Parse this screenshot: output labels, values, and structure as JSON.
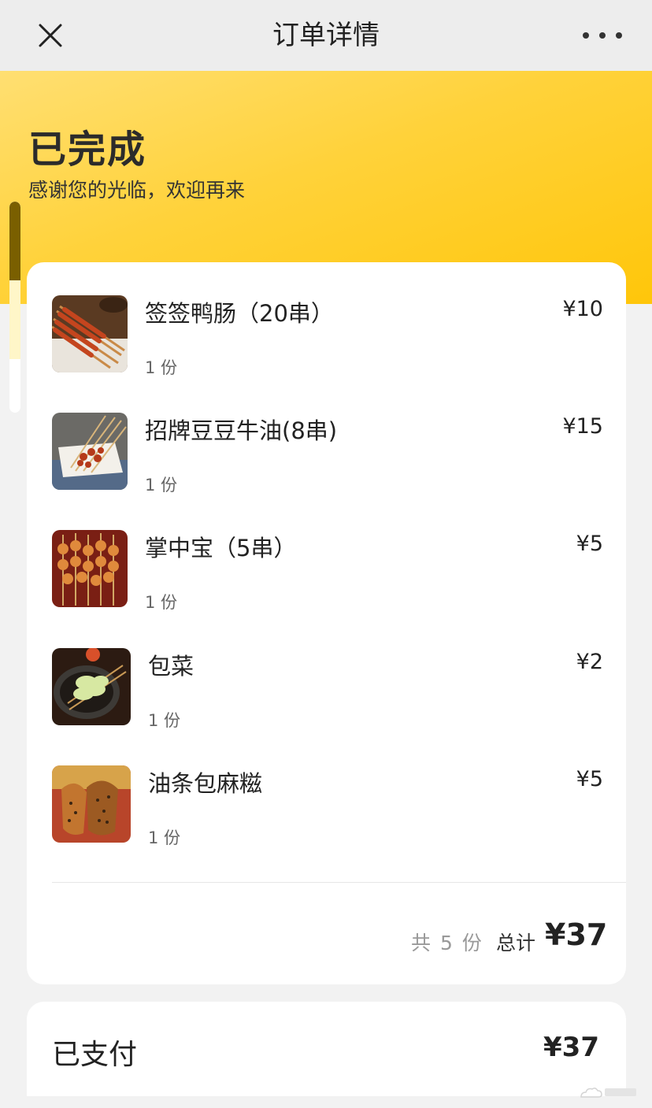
{
  "nav": {
    "title": "订单详情",
    "close_icon": "close-icon",
    "more_icon": "more-icon"
  },
  "status": {
    "title": "已完成",
    "subtitle": "感谢您的光临，欢迎再来"
  },
  "items": [
    {
      "name": "签签鸭肠（20串）",
      "price": "¥10",
      "qty": "1 份"
    },
    {
      "name": "招牌豆豆牛油(8串)",
      "price": "¥15",
      "qty": "1 份"
    },
    {
      "name": "掌中宝（5串）",
      "price": "¥5",
      "qty": "1 份"
    },
    {
      "name": "包菜",
      "price": "¥2",
      "qty": "1 份"
    },
    {
      "name": "油条包麻糍",
      "price": "¥5",
      "qty": "1 份"
    }
  ],
  "summary": {
    "count": "共 5 份",
    "total_label": "总计",
    "total": "¥37"
  },
  "payment": {
    "label": "已支付",
    "amount": "¥37"
  },
  "colors": {
    "banner_start": "#ffdf72",
    "banner_end": "#ffc60a",
    "page_bg": "#f2f2f2"
  }
}
